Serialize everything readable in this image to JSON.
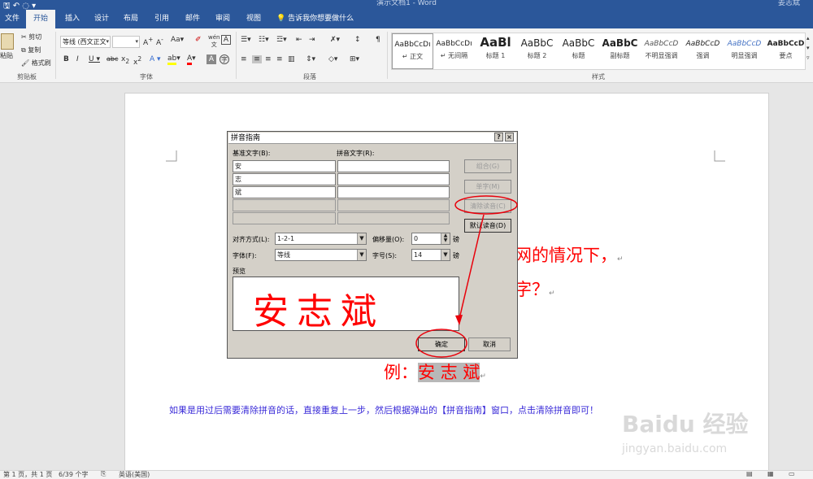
{
  "titlebar": {
    "title": "演示文档1 - Word",
    "user": "姜志斌"
  },
  "tabs": [
    "文件",
    "开始",
    "插入",
    "设计",
    "布局",
    "引用",
    "邮件",
    "审阅",
    "视图"
  ],
  "tell_me": "告诉我你想要做什么",
  "ribbon": {
    "clipboard": {
      "paste": "粘贴",
      "cut": "剪切",
      "copy": "复制",
      "format_painter": "格式刷",
      "label": "剪贴板"
    },
    "font": {
      "font_name": "等线 (西文正文",
      "font_size": "",
      "label": "字体"
    },
    "paragraph": {
      "label": "段落"
    },
    "styles": {
      "label": "样式",
      "items": [
        {
          "preview": "AaBbCcDı",
          "name": "↵ 正文"
        },
        {
          "preview": "AaBbCcDı",
          "name": "↵ 无间隔"
        },
        {
          "preview": "AaBl",
          "name": "标题 1"
        },
        {
          "preview": "AaBbC",
          "name": "标题 2"
        },
        {
          "preview": "AaBbC",
          "name": "标题"
        },
        {
          "preview": "AaBbC",
          "name": "副标题"
        },
        {
          "preview": "AaBbCcD",
          "name": "不明显强调"
        },
        {
          "preview": "AaBbCcD",
          "name": "强调"
        },
        {
          "preview": "AaBbCcD",
          "name": "明显强调"
        },
        {
          "preview": "AaBbCcD",
          "name": "要点"
        }
      ]
    }
  },
  "document": {
    "line1": "网的情况下，",
    "line2": "字？",
    "example_label": "例：",
    "example_chars": "安 志 斌",
    "note": "如果是用过后需要清除拼音的话，直接重复上一步，然后根据弹出的【拼音指南】窗口，点击清除拼音即可！"
  },
  "dialog": {
    "title": "拼音指南",
    "base_label": "基准文字(B):",
    "pinyin_label": "拼音文字(R):",
    "rows": [
      {
        "base": "安",
        "pinyin": ""
      },
      {
        "base": "志",
        "pinyin": ""
      },
      {
        "base": "斌",
        "pinyin": ""
      }
    ],
    "buttons": {
      "combine": "组合(G)",
      "single": "单字(M)",
      "clear": "清除读音(C)",
      "default": "默认读音(D)",
      "ok": "确定",
      "cancel": "取消"
    },
    "align_label": "对齐方式(L):",
    "align_value": "1-2-1",
    "offset_label": "偏移量(O):",
    "offset_value": "0",
    "offset_unit": "磅",
    "font_label": "字体(F):",
    "font_value": "等线",
    "size_label": "字号(S):",
    "size_value": "14",
    "size_unit": "磅",
    "preview_label": "预览",
    "preview_text": "安志斌"
  },
  "statusbar": {
    "page": "第 1 页，共 1 页",
    "words": "6/39 个字",
    "lang": "英语(美国)"
  },
  "watermark": {
    "brand": "Baidu 经验",
    "url": "jingyan.baidu.com"
  },
  "colors": {
    "word_blue": "#2b579a",
    "annotation_red": "#e8000b",
    "doc_red": "#ff0000",
    "note_blue": "#3a2bd8"
  }
}
